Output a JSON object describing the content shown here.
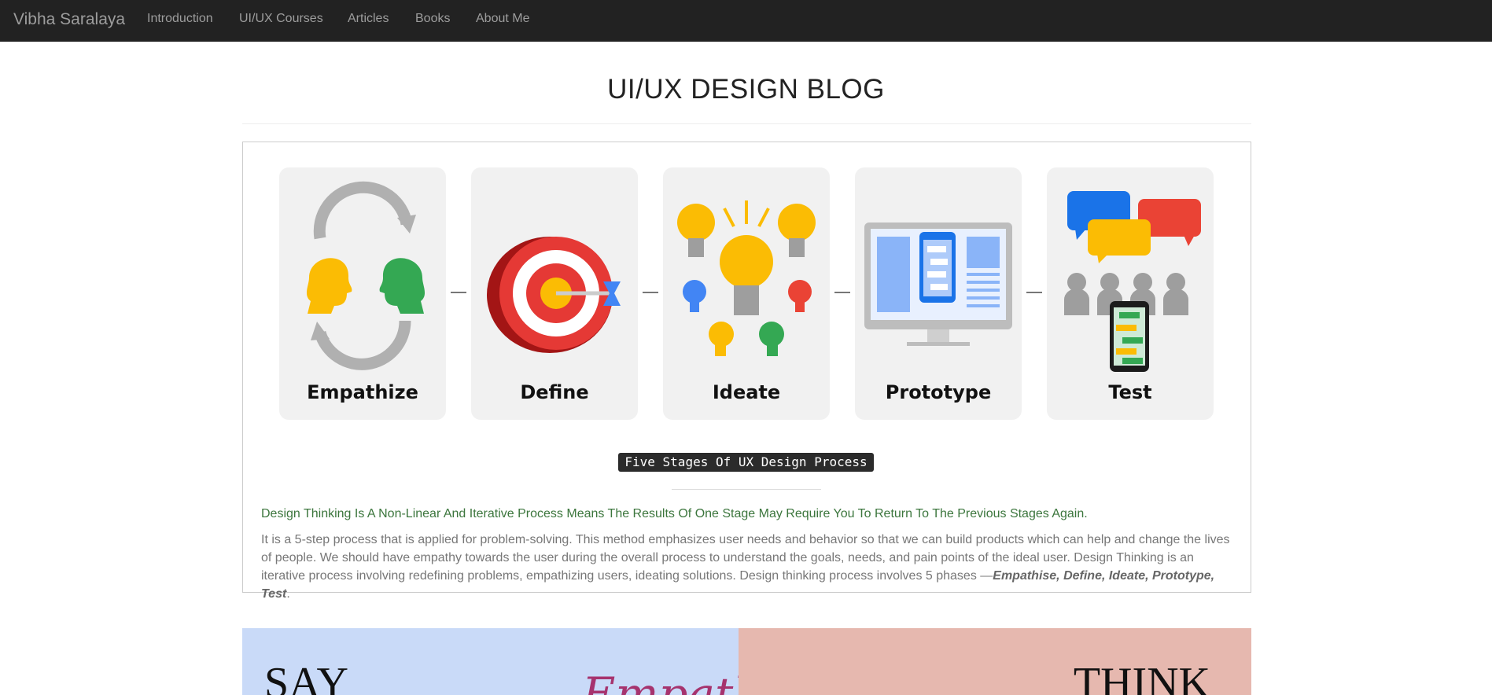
{
  "nav": {
    "brand": "Vibha Saralaya",
    "items": [
      "Introduction",
      "UI/UX Courses",
      "Articles",
      "Books",
      "About Me"
    ]
  },
  "header": {
    "title": "UI/UX DESIGN BLOG"
  },
  "article": {
    "stages": [
      "Empathize",
      "Define",
      "Ideate",
      "Prototype",
      "Test"
    ],
    "caption": "Five Stages Of UX Design Process",
    "lead": "Design Thinking Is A Non-Linear And Iterative Process Means The Results Of One Stage May Require You To Return To The Previous Stages Again.",
    "body": "It is a 5-step process that is applied for problem-solving. This method emphasizes user needs and behavior so that we can build products which can help and change the lives of people. We should have empathy towards the user during the overall process to understand the goals, needs, and pain points of the ideal user. Design Thinking is an iterative process involving redefining problems, empathizing users, ideating solutions. Design thinking process involves 5 phases —",
    "phases": "Empathise, Define, Ideate, Prototype, Test",
    "body_end": "."
  },
  "banner": {
    "left": "SAY",
    "center": "Empathy",
    "right": "THINK"
  },
  "colors": {
    "navbar": "#222222",
    "green": "#3c763d",
    "yellow": "#fbbc04",
    "blue": "#4285f4",
    "red": "#ea4335",
    "green_icon": "#34a853"
  }
}
